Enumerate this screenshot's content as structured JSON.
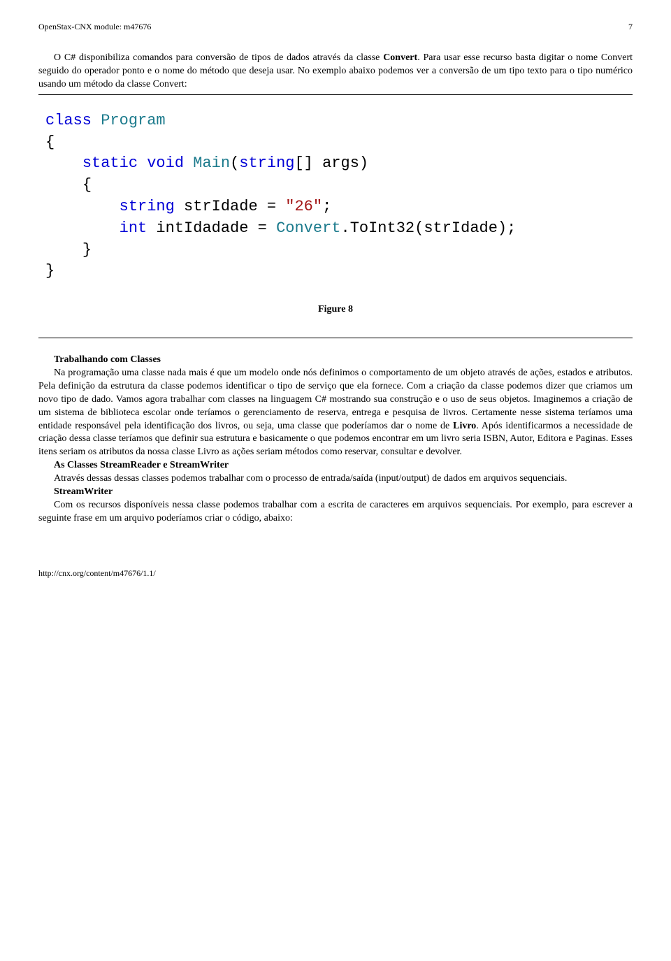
{
  "header": {
    "module": "OpenStax-CNX module: m47676",
    "page": "7"
  },
  "intro": {
    "p1_a": "O C# disponibiliza comandos para conversão de tipos de dados através da classe ",
    "p1_b": "Convert",
    "p1_c": ". Para usar esse recurso basta digitar o nome Convert seguido do operador ponto e o nome do método que deseja usar. No exemplo abaixo podemos ver a conversão de um tipo texto para o tipo numérico usando um método da classe Convert:"
  },
  "code": {
    "kw_class": "class",
    "cls_program": "Program",
    "brace_open": "{",
    "kw_static": "static",
    "kw_void": "void",
    "cls_main": "Main",
    "paren_open": "(",
    "kw_string_arr": "string",
    "args": "[] args)",
    "kw_string": "string",
    "var1": " strIdade = ",
    "str1": "\"26\"",
    "semi": ";",
    "kw_int": "int",
    "var2": " intIdadade = ",
    "cls_convert": "Convert",
    "call": ".ToInt32(strIdade);",
    "brace_close": "}"
  },
  "figure": {
    "caption": "Figure 8"
  },
  "section1": {
    "title": "Trabalhando com Classes",
    "p_a": "Na programação uma classe nada mais é que um modelo onde nós definimos o comportamento de um objeto através de ações, estados e atributos. Pela definição da estrutura da classe podemos identificar o tipo de serviço que ela fornece. Com a criação da classe podemos dizer que criamos um novo tipo de dado. Vamos agora trabalhar com classes na linguagem C# mostrando sua construção e o uso de seus objetos. Imaginemos a criação de um sistema de biblioteca escolar onde teríamos o gerenciamento de reserva, entrega e pesquisa de livros. Certamente nesse sistema teríamos uma entidade responsável pela identificação dos livros, ou seja, uma classe que poderíamos dar o nome de ",
    "livro": "Livro",
    "p_b": ". Após identificarmos a necessidade de criação dessa classe teríamos que definir sua estrutura e basicamente o que podemos encontrar em um livro seria ISBN, Autor, Editora e Paginas. Esses itens seriam os atributos da nossa classe Livro as ações seriam métodos como reservar, consultar e devolver."
  },
  "section2": {
    "title": "As Classes StreamReader e StreamWriter",
    "p": "Através dessas dessas classes podemos trabalhar com o processo de entrada/saída (input/output) de dados em arquivos sequenciais."
  },
  "section3": {
    "title": "StreamWriter",
    "p": "Com os recursos disponíveis nessa classe podemos trabalhar com a escrita de caracteres em arquivos sequenciais. Por exemplo, para escrever a seguinte frase em um arquivo poderíamos criar o código, abaixo:"
  },
  "footer": {
    "url": "http://cnx.org/content/m47676/1.1/"
  }
}
